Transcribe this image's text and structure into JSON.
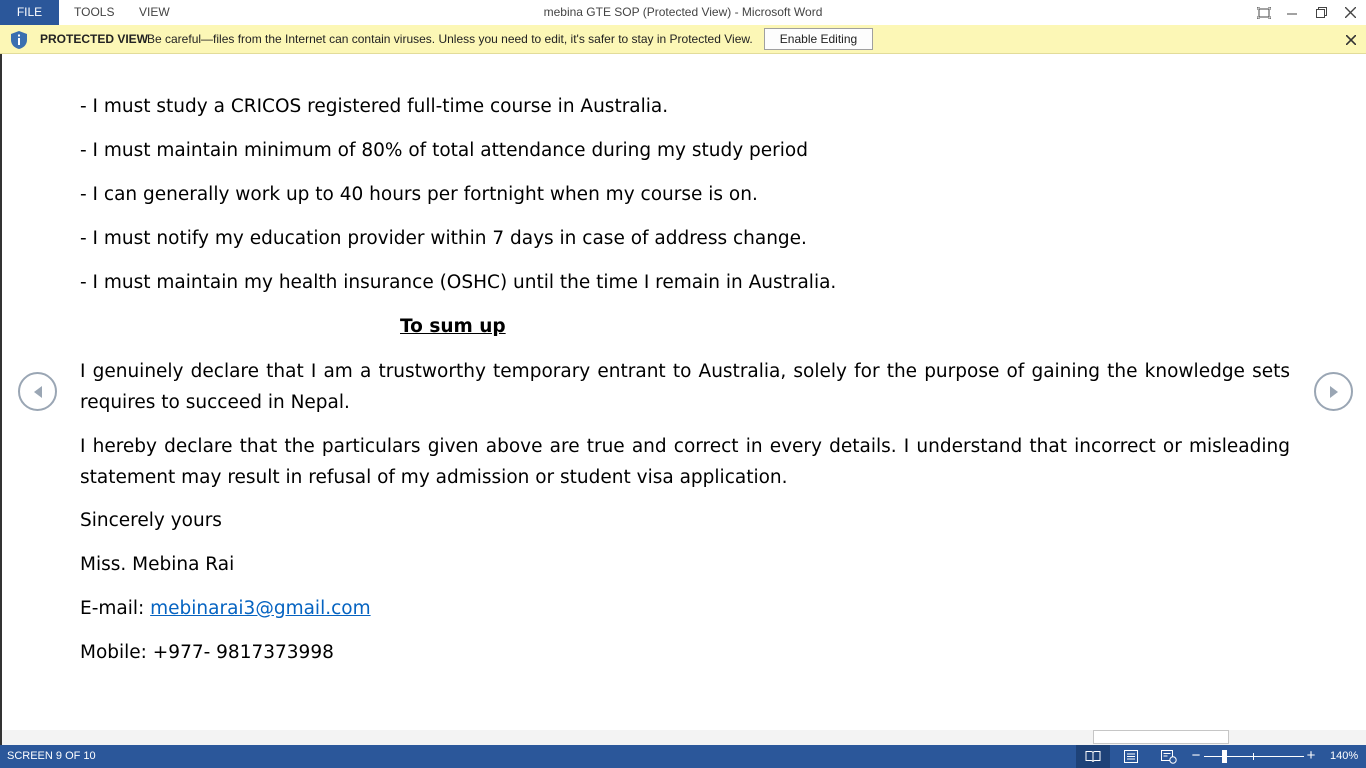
{
  "menu": {
    "file": "FILE",
    "tools": "TOOLS",
    "view": "VIEW"
  },
  "window": {
    "title": "mebina GTE SOP (Protected View) - Microsoft Word"
  },
  "protected_view": {
    "title": "PROTECTED VIEW",
    "message": "Be careful—files from the Internet can contain viruses. Unless you need to edit, it's safer to stay in Protected View.",
    "enable_button": "Enable Editing"
  },
  "document": {
    "bullets": [
      "-  I must study a CRICOS registered full-time course in Australia.",
      "-  I must maintain minimum of 80% of total attendance during my study period",
      "-  I can generally work up to 40 hours per fortnight when my course is on.",
      "-  I must notify my education provider within 7 days in case of address change.",
      "-  I must maintain my health insurance (OSHC) until the time I remain in Australia."
    ],
    "heading": "To sum up",
    "paragraph1": "I genuinely declare that I am a trustworthy temporary entrant to Australia, solely for the purpose of gaining the knowledge sets requires to succeed in Nepal.",
    "paragraph2": "I hereby declare that the particulars given above are true and correct in every details. I understand that incorrect or misleading statement may result in refusal of my admission or student visa application.",
    "closing": "Sincerely yours",
    "name": "Miss. Mebina Rai",
    "email_label": "E-mail: ",
    "email": "mebinarai3@gmail.com",
    "mobile": "Mobile: +977- 9817373998"
  },
  "status": {
    "pages": "SCREEN 9 OF 10",
    "zoom": "140%"
  },
  "colors": {
    "accent": "#2b579a",
    "protected_bar": "#fcf7b6",
    "link": "#0563c1"
  }
}
